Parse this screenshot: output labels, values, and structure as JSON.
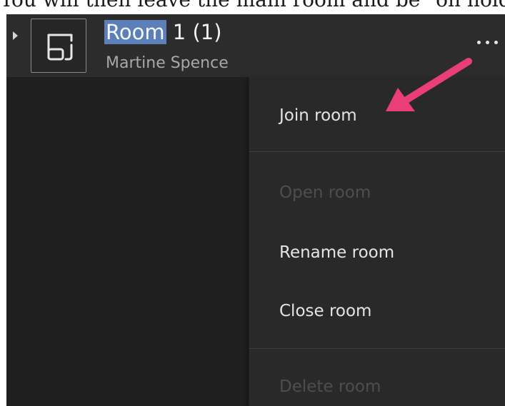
{
  "caption_text": "You will then leave the main room and be \"on hold\"",
  "room": {
    "highlighted_word": "Room",
    "title_rest": " 1 (1)",
    "subtitle": "Martine Spence"
  },
  "icons": {
    "expand": "chevron-right-icon",
    "room": "breakout-room-icon",
    "more": "more-options-icon"
  },
  "context_menu": {
    "items": [
      {
        "label": "Join room",
        "enabled": true
      },
      {
        "label": "Open room",
        "enabled": false
      },
      {
        "label": "Rename room",
        "enabled": true
      },
      {
        "label": "Close room",
        "enabled": true
      },
      {
        "label": "Delete room",
        "enabled": false
      }
    ]
  },
  "colors": {
    "app_background": "#1f1f1f",
    "row_background": "#2d2c2c",
    "menu_background": "#292929",
    "selection_highlight": "#5b7fb6",
    "annotation_arrow": "#ea3e78"
  }
}
